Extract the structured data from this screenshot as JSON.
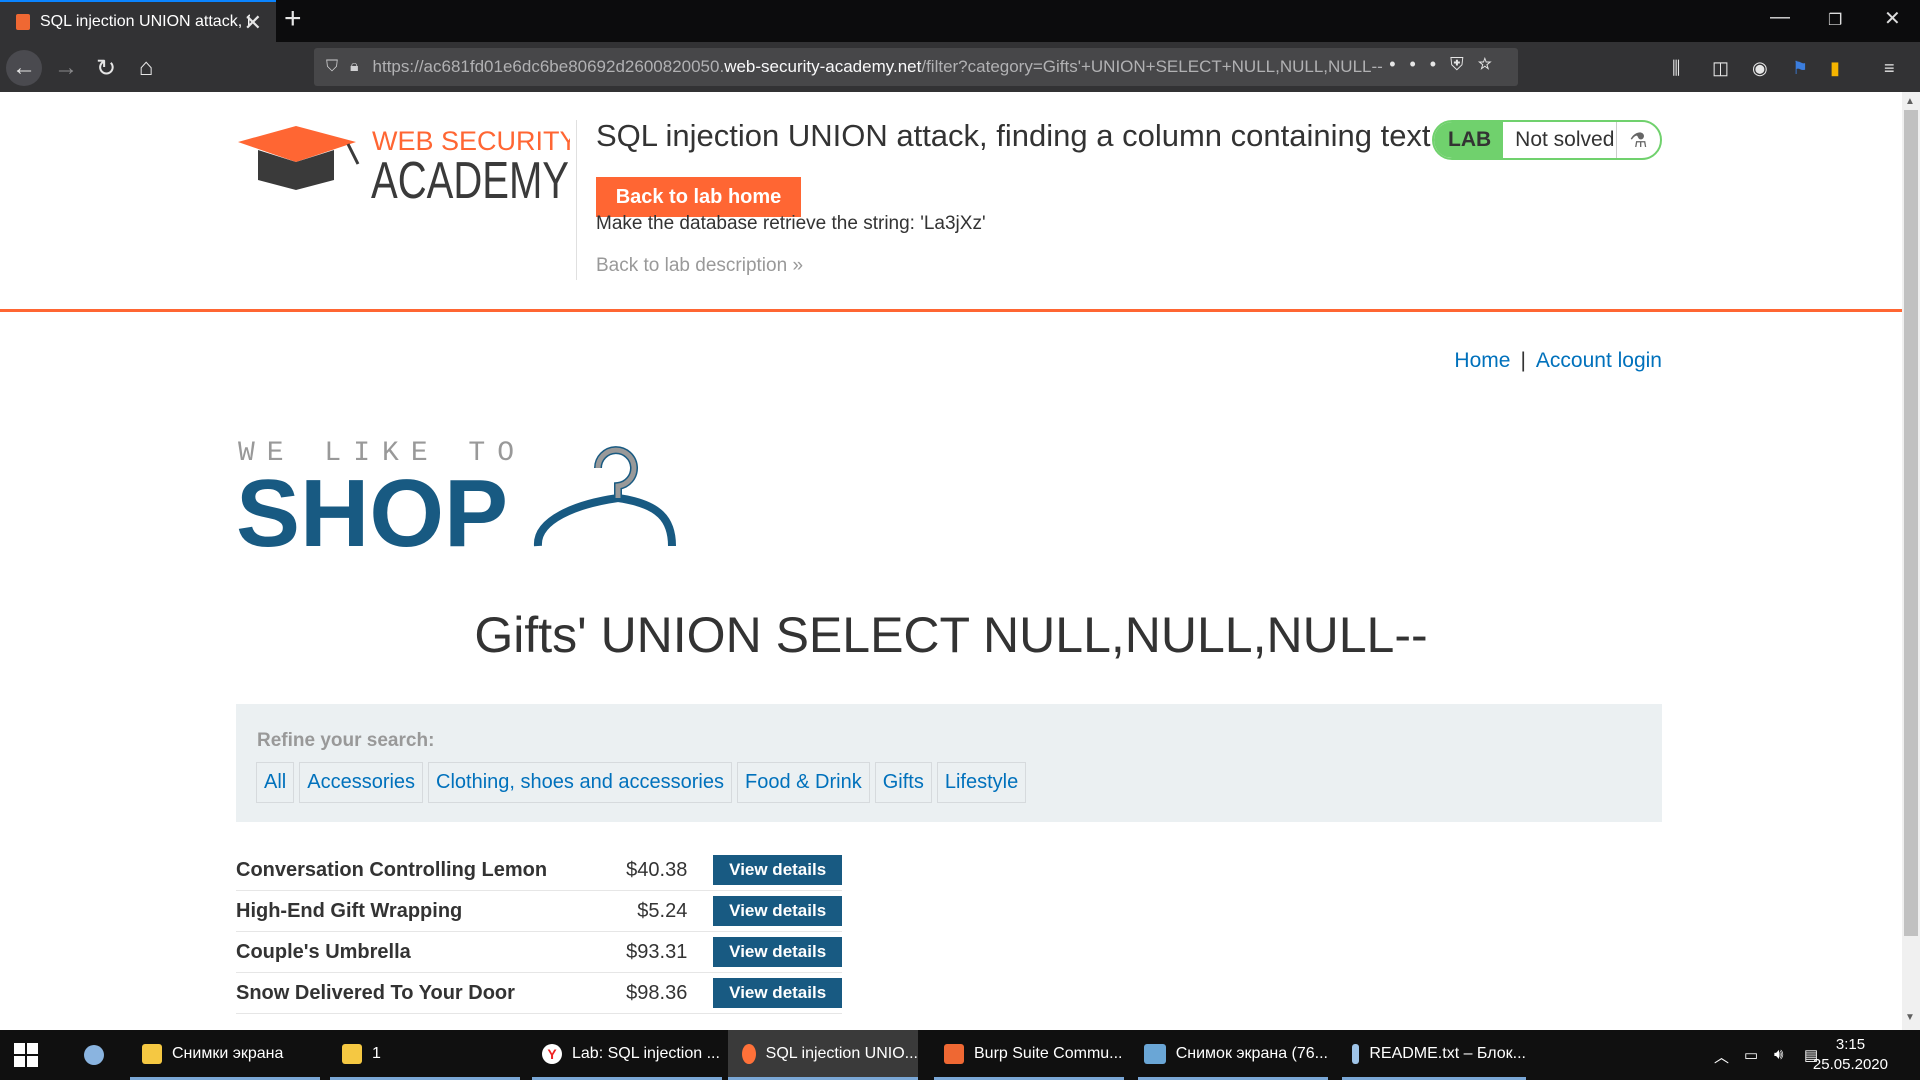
{
  "browser": {
    "tab_title": "SQL injection UNION attack, finding a column containing text",
    "url_prefix": "https://ac681fd01e6dc6be80692d2600820050.",
    "url_host": "web-security-academy.net",
    "url_path": "/filter?category=Gifts'+UNION+SELECT+NULL,NULL,NULL--",
    "url_actions": "•••"
  },
  "academy": {
    "logo_line1": "WEB SECURITY",
    "logo_line2": "ACADEMY",
    "lab_title": "SQL injection UNION attack, finding a column containing text",
    "badge_label": "LAB",
    "badge_status": "Not solved",
    "back_home_label": "Back to lab home",
    "goal_text": "Make the database retrieve the string: 'La3jXz'",
    "back_description_label": "Back to lab description »"
  },
  "shop": {
    "nav_home": "Home",
    "nav_separator": "|",
    "nav_account": "Account login",
    "logo_tagline": "WE LIKE TO",
    "logo_word": "SHOP",
    "category_heading": "Gifts' UNION SELECT NULL,NULL,NULL--",
    "refine_label": "Refine your search:",
    "filters": [
      "All",
      "Accessories",
      "Clothing, shoes and accessories",
      "Food & Drink",
      "Gifts",
      "Lifestyle"
    ],
    "view_details_label": "View details",
    "products": [
      {
        "name": "Conversation Controlling Lemon",
        "price": "$40.38"
      },
      {
        "name": "High-End Gift Wrapping",
        "price": "$5.24"
      },
      {
        "name": "Couple's Umbrella",
        "price": "$93.31"
      },
      {
        "name": "Snow Delivered To Your Door",
        "price": "$98.36"
      }
    ]
  },
  "taskbar": {
    "items": [
      {
        "label": "Снимки экрана",
        "icon": "folder-icon",
        "color": "#f5c842"
      },
      {
        "label": "1",
        "icon": "folder-icon",
        "color": "#f5c842"
      },
      {
        "label": "Lab: SQL injection ...",
        "icon": "yandex-browser-icon",
        "color": "#ffffff"
      },
      {
        "label": "SQL injection UNIO...",
        "icon": "firefox-icon",
        "color": "#ff7139"
      },
      {
        "label": "Burp Suite Commu...",
        "icon": "burp-suite-icon",
        "color": "#ef6833"
      },
      {
        "label": "Снимок экрана (76...",
        "icon": "photos-icon",
        "color": "#6aa6d6"
      },
      {
        "label": "README.txt – Блок...",
        "icon": "notepad-icon",
        "color": "#9fc4e8"
      }
    ],
    "time": "3:15",
    "date": "25.05.2020"
  },
  "colors": {
    "accent": "#ff6633",
    "link": "#0071bc",
    "button": "#185a82",
    "solved_badge": "#70d16d"
  }
}
